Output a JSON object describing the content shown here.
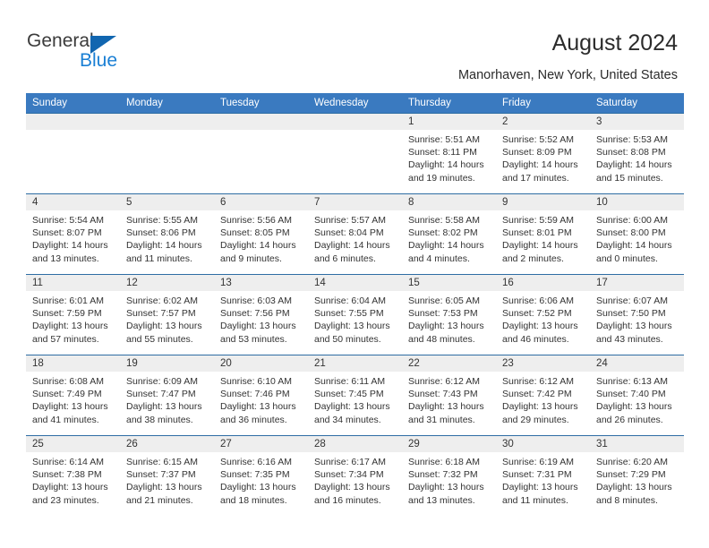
{
  "brand": {
    "name_part1": "General",
    "name_part2": "Blue",
    "accent_color": "#1a7fd4"
  },
  "header": {
    "title": "August 2024",
    "location": "Manorhaven, New York, United States"
  },
  "theme": {
    "header_blue": "#3a7ac0",
    "row_border": "#2e6da4",
    "daynum_band": "#eeeeee"
  },
  "weekdays": [
    "Sunday",
    "Monday",
    "Tuesday",
    "Wednesday",
    "Thursday",
    "Friday",
    "Saturday"
  ],
  "labels": {
    "sunrise": "Sunrise:",
    "sunset": "Sunset:",
    "daylight": "Daylight:"
  },
  "weeks": [
    [
      {
        "day": "",
        "lines": []
      },
      {
        "day": "",
        "lines": []
      },
      {
        "day": "",
        "lines": []
      },
      {
        "day": "",
        "lines": []
      },
      {
        "day": "1",
        "lines": [
          "Sunrise: 5:51 AM",
          "Sunset: 8:11 PM",
          "Daylight: 14 hours",
          "and 19 minutes."
        ]
      },
      {
        "day": "2",
        "lines": [
          "Sunrise: 5:52 AM",
          "Sunset: 8:09 PM",
          "Daylight: 14 hours",
          "and 17 minutes."
        ]
      },
      {
        "day": "3",
        "lines": [
          "Sunrise: 5:53 AM",
          "Sunset: 8:08 PM",
          "Daylight: 14 hours",
          "and 15 minutes."
        ]
      }
    ],
    [
      {
        "day": "4",
        "lines": [
          "Sunrise: 5:54 AM",
          "Sunset: 8:07 PM",
          "Daylight: 14 hours",
          "and 13 minutes."
        ]
      },
      {
        "day": "5",
        "lines": [
          "Sunrise: 5:55 AM",
          "Sunset: 8:06 PM",
          "Daylight: 14 hours",
          "and 11 minutes."
        ]
      },
      {
        "day": "6",
        "lines": [
          "Sunrise: 5:56 AM",
          "Sunset: 8:05 PM",
          "Daylight: 14 hours",
          "and 9 minutes."
        ]
      },
      {
        "day": "7",
        "lines": [
          "Sunrise: 5:57 AM",
          "Sunset: 8:04 PM",
          "Daylight: 14 hours",
          "and 6 minutes."
        ]
      },
      {
        "day": "8",
        "lines": [
          "Sunrise: 5:58 AM",
          "Sunset: 8:02 PM",
          "Daylight: 14 hours",
          "and 4 minutes."
        ]
      },
      {
        "day": "9",
        "lines": [
          "Sunrise: 5:59 AM",
          "Sunset: 8:01 PM",
          "Daylight: 14 hours",
          "and 2 minutes."
        ]
      },
      {
        "day": "10",
        "lines": [
          "Sunrise: 6:00 AM",
          "Sunset: 8:00 PM",
          "Daylight: 14 hours",
          "and 0 minutes."
        ]
      }
    ],
    [
      {
        "day": "11",
        "lines": [
          "Sunrise: 6:01 AM",
          "Sunset: 7:59 PM",
          "Daylight: 13 hours",
          "and 57 minutes."
        ]
      },
      {
        "day": "12",
        "lines": [
          "Sunrise: 6:02 AM",
          "Sunset: 7:57 PM",
          "Daylight: 13 hours",
          "and 55 minutes."
        ]
      },
      {
        "day": "13",
        "lines": [
          "Sunrise: 6:03 AM",
          "Sunset: 7:56 PM",
          "Daylight: 13 hours",
          "and 53 minutes."
        ]
      },
      {
        "day": "14",
        "lines": [
          "Sunrise: 6:04 AM",
          "Sunset: 7:55 PM",
          "Daylight: 13 hours",
          "and 50 minutes."
        ]
      },
      {
        "day": "15",
        "lines": [
          "Sunrise: 6:05 AM",
          "Sunset: 7:53 PM",
          "Daylight: 13 hours",
          "and 48 minutes."
        ]
      },
      {
        "day": "16",
        "lines": [
          "Sunrise: 6:06 AM",
          "Sunset: 7:52 PM",
          "Daylight: 13 hours",
          "and 46 minutes."
        ]
      },
      {
        "day": "17",
        "lines": [
          "Sunrise: 6:07 AM",
          "Sunset: 7:50 PM",
          "Daylight: 13 hours",
          "and 43 minutes."
        ]
      }
    ],
    [
      {
        "day": "18",
        "lines": [
          "Sunrise: 6:08 AM",
          "Sunset: 7:49 PM",
          "Daylight: 13 hours",
          "and 41 minutes."
        ]
      },
      {
        "day": "19",
        "lines": [
          "Sunrise: 6:09 AM",
          "Sunset: 7:47 PM",
          "Daylight: 13 hours",
          "and 38 minutes."
        ]
      },
      {
        "day": "20",
        "lines": [
          "Sunrise: 6:10 AM",
          "Sunset: 7:46 PM",
          "Daylight: 13 hours",
          "and 36 minutes."
        ]
      },
      {
        "day": "21",
        "lines": [
          "Sunrise: 6:11 AM",
          "Sunset: 7:45 PM",
          "Daylight: 13 hours",
          "and 34 minutes."
        ]
      },
      {
        "day": "22",
        "lines": [
          "Sunrise: 6:12 AM",
          "Sunset: 7:43 PM",
          "Daylight: 13 hours",
          "and 31 minutes."
        ]
      },
      {
        "day": "23",
        "lines": [
          "Sunrise: 6:12 AM",
          "Sunset: 7:42 PM",
          "Daylight: 13 hours",
          "and 29 minutes."
        ]
      },
      {
        "day": "24",
        "lines": [
          "Sunrise: 6:13 AM",
          "Sunset: 7:40 PM",
          "Daylight: 13 hours",
          "and 26 minutes."
        ]
      }
    ],
    [
      {
        "day": "25",
        "lines": [
          "Sunrise: 6:14 AM",
          "Sunset: 7:38 PM",
          "Daylight: 13 hours",
          "and 23 minutes."
        ]
      },
      {
        "day": "26",
        "lines": [
          "Sunrise: 6:15 AM",
          "Sunset: 7:37 PM",
          "Daylight: 13 hours",
          "and 21 minutes."
        ]
      },
      {
        "day": "27",
        "lines": [
          "Sunrise: 6:16 AM",
          "Sunset: 7:35 PM",
          "Daylight: 13 hours",
          "and 18 minutes."
        ]
      },
      {
        "day": "28",
        "lines": [
          "Sunrise: 6:17 AM",
          "Sunset: 7:34 PM",
          "Daylight: 13 hours",
          "and 16 minutes."
        ]
      },
      {
        "day": "29",
        "lines": [
          "Sunrise: 6:18 AM",
          "Sunset: 7:32 PM",
          "Daylight: 13 hours",
          "and 13 minutes."
        ]
      },
      {
        "day": "30",
        "lines": [
          "Sunrise: 6:19 AM",
          "Sunset: 7:31 PM",
          "Daylight: 13 hours",
          "and 11 minutes."
        ]
      },
      {
        "day": "31",
        "lines": [
          "Sunrise: 6:20 AM",
          "Sunset: 7:29 PM",
          "Daylight: 13 hours",
          "and 8 minutes."
        ]
      }
    ]
  ]
}
